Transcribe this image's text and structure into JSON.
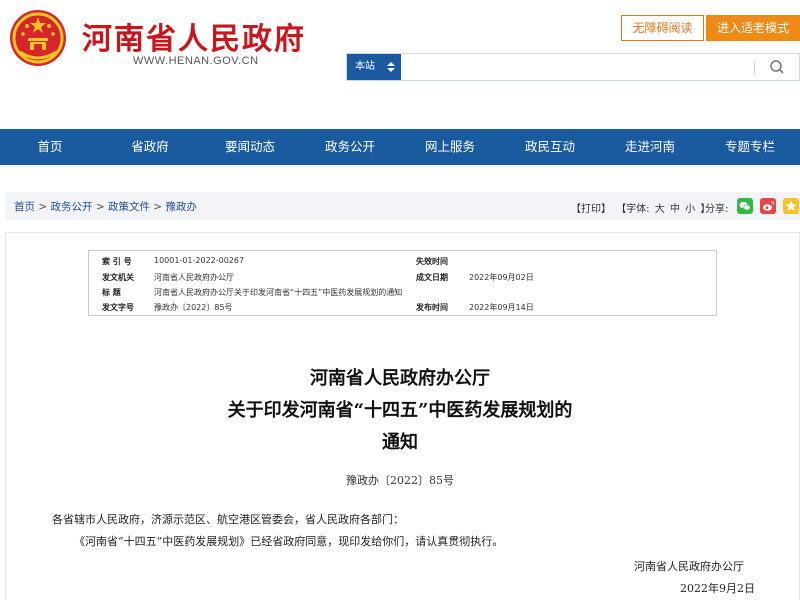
{
  "header": {
    "site_title": "河南省人民政府",
    "domain": "WWW.HENAN.GOV.CN",
    "accessible_label": "无障碍阅读",
    "elder_mode_label": "进入适老模式"
  },
  "search": {
    "scope": "本站",
    "value": ""
  },
  "nav": {
    "items": [
      "首页",
      "省政府",
      "要闻动态",
      "政务公开",
      "网上服务",
      "政民互动",
      "走进河南",
      "专题专栏"
    ]
  },
  "breadcrumb": [
    "首页",
    "政务公开",
    "政策文件",
    "豫政办"
  ],
  "breadcrumb_separator": " > ",
  "tools": {
    "print": "【打印】",
    "font_prefix": "【字体:",
    "font_large": "大",
    "font_medium": "中",
    "font_small": "小",
    "font_suffix": "】",
    "share_label": "分享:"
  },
  "meta": {
    "index_label": "索 引 号",
    "index_value": "10001-01-2022-00267",
    "expiry_label": "失效时间",
    "expiry_value": "",
    "issuer_label": "发文机关",
    "issuer_value": "河南省人民政府办公厅",
    "written_label": "成文日期",
    "written_value": "2022年09月02日",
    "title_label": "标 题",
    "title_value": "河南省人民政府办公厅关于印发河南省“十四五”中医药发展规划的通知",
    "docno_label": "发文字号",
    "docno_value": "豫政办〔2022〕85号",
    "publish_label": "发布时间",
    "publish_value": "2022年09月14日"
  },
  "document": {
    "title_line1": "河南省人民政府办公厅",
    "title_line2": "关于印发河南省“十四五”中医药发展规划的",
    "title_line3": "通知",
    "doc_number": "豫政办〔2022〕85号",
    "recipients": "各省辖市人民政府，济源示范区、航空港区管委会，省人民政府各部门：",
    "body": "《河南省“十四五”中医药发展规划》已经省政府同意，现印发给你们，请认真贯彻执行。",
    "signature": "河南省人民政府办公厅",
    "date": "2022年9月2日"
  },
  "colors": {
    "brand_red": "#c8161d",
    "nav_blue": "#1a5a9e",
    "accent_orange": "#ef8a17"
  },
  "icons": {
    "emblem": "national-emblem-icon",
    "search": "search-icon",
    "wechat": "wechat-icon",
    "weibo": "weibo-icon",
    "qzone": "qzone-icon"
  }
}
